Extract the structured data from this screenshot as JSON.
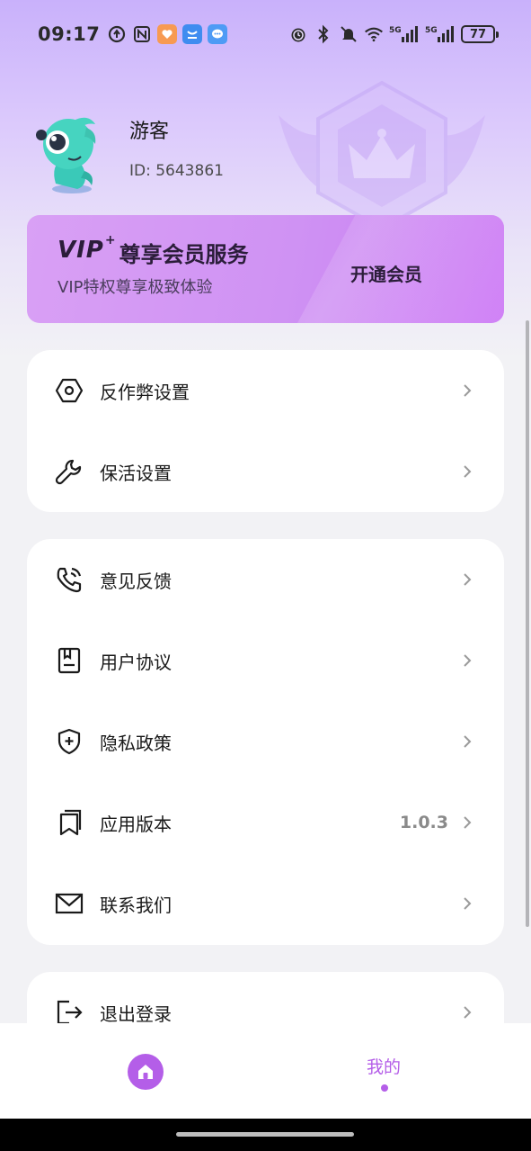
{
  "status_bar": {
    "time": "09:17",
    "left_icons": [
      "sync-icon",
      "nfc-icon",
      "heart-app-icon",
      "shop-app-icon",
      "chat-app-icon"
    ],
    "right_icons": [
      "alarm-icon",
      "bluetooth-icon",
      "mute-icon",
      "wifi-icon",
      "signal-5g-icon",
      "signal-5g-icon"
    ],
    "network_label": "5G",
    "battery_level": "77"
  },
  "profile": {
    "name": "游客",
    "id_text": "ID: 5643861"
  },
  "vip": {
    "logo": "VIP",
    "logo_plus": "+",
    "heading": "尊享会员服务",
    "subtitle": "VIP特权尊享极致体验",
    "action": "开通会员"
  },
  "menu_group_1": [
    {
      "label": "反作弊设置",
      "icon": "hexagon-settings-icon"
    },
    {
      "label": "保活设置",
      "icon": "wrench-icon"
    }
  ],
  "menu_group_2": [
    {
      "label": "意见反馈",
      "icon": "phone-call-icon"
    },
    {
      "label": "用户协议",
      "icon": "document-icon"
    },
    {
      "label": "隐私政策",
      "icon": "shield-plus-icon"
    },
    {
      "label": "应用版本",
      "icon": "bookmark-icon",
      "value": "1.0.3"
    },
    {
      "label": "联系我们",
      "icon": "mail-icon"
    }
  ],
  "menu_group_3": [
    {
      "label": "退出登录",
      "icon": "logout-icon"
    }
  ],
  "bottom_nav": {
    "home_icon": "home-icon",
    "mine_label": "我的",
    "active_tab": "我的"
  },
  "colors": {
    "accent": "#b45ee8",
    "vip_start": "#d9a0f5",
    "vip_end": "#c779f2",
    "header_top": "#c9b1fb",
    "background": "#f2f2f5"
  }
}
